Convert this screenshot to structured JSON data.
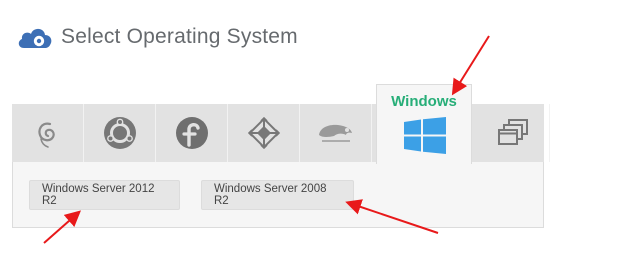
{
  "header": {
    "title": "Select Operating System",
    "logo_icon": "cloud-gear-icon"
  },
  "os_tabs": [
    {
      "icon": "debian-icon"
    },
    {
      "icon": "ubuntu-icon"
    },
    {
      "icon": "fedora-icon"
    },
    {
      "icon": "centos-icon"
    },
    {
      "icon": "opensuse-icon"
    },
    {
      "icon": "windows-icon",
      "label": "Windows",
      "selected": true
    },
    {
      "icon": "other-os-windows-icon"
    }
  ],
  "versions": [
    {
      "label": "Windows Server 2012 R2"
    },
    {
      "label": "Windows Server 2008 R2"
    }
  ],
  "colors": {
    "accent": "#27ae78",
    "windows_blue": "#3ca0e6",
    "annotation_arrow": "#e8191a"
  }
}
